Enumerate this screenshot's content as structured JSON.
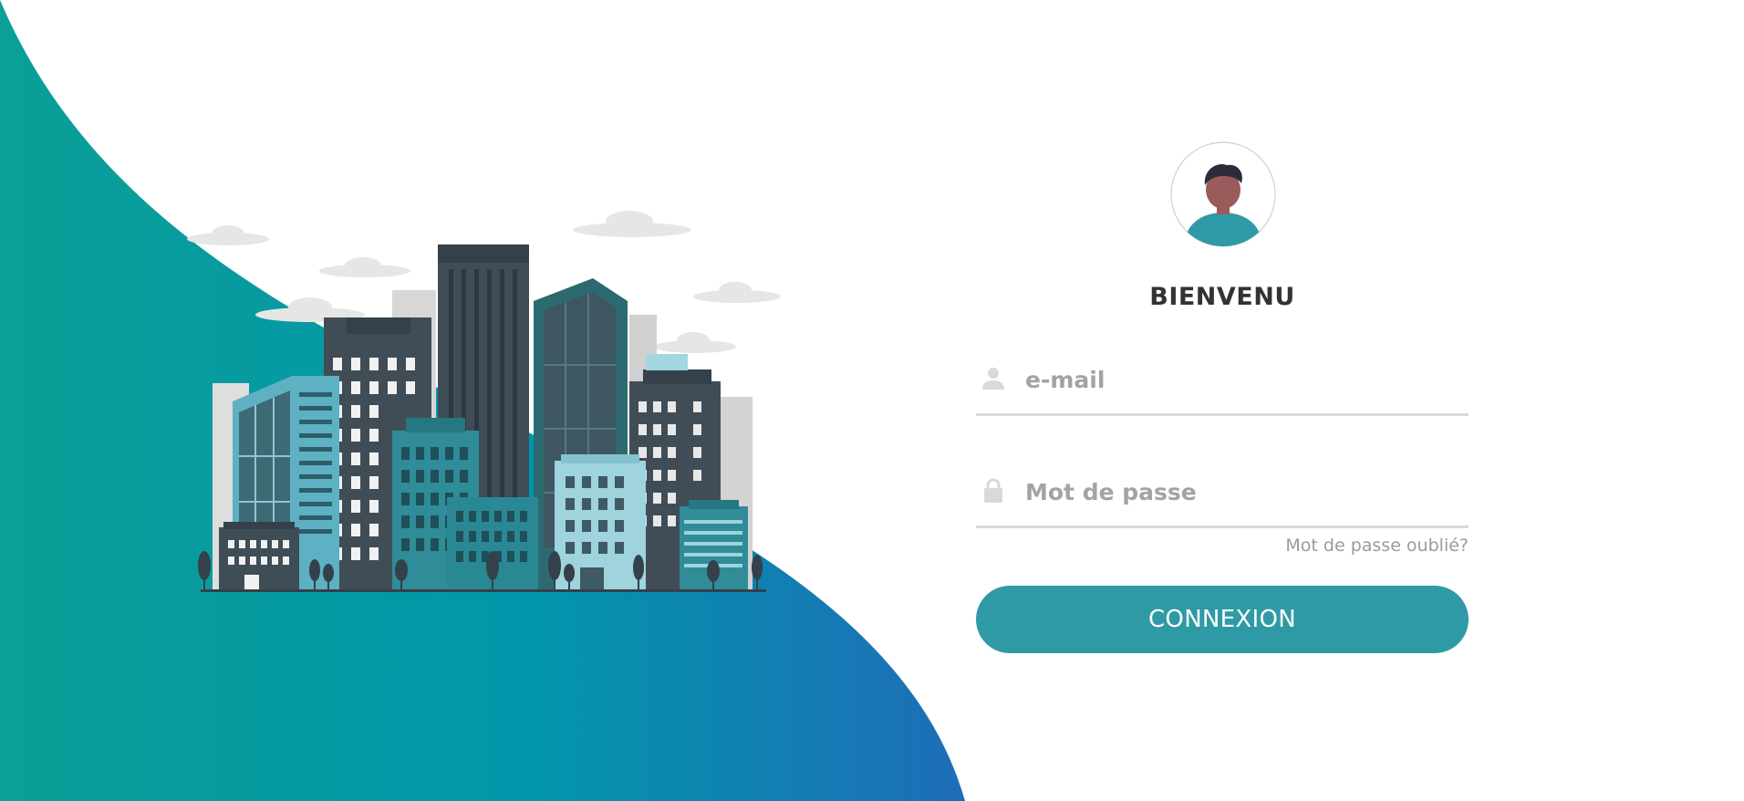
{
  "colors": {
    "gradient_start": "#0b9f97",
    "gradient_mid": "#0296ab",
    "gradient_end": "#1e6db7",
    "accent": "#2e9aa6",
    "text_dark": "#333333",
    "placeholder": "#a3a3a3",
    "field_line": "#d9d9d9"
  },
  "illustration": {
    "name": "city-buildings-illustration"
  },
  "login": {
    "avatar_icon": "user-avatar-icon",
    "title": "BIENVENU",
    "email": {
      "icon": "user-icon",
      "placeholder": "e-mail",
      "value": ""
    },
    "password": {
      "icon": "lock-icon",
      "placeholder": "Mot de passe",
      "value": ""
    },
    "forgot_link": "Mot de passe oublié?",
    "submit_label": "CONNEXION"
  }
}
